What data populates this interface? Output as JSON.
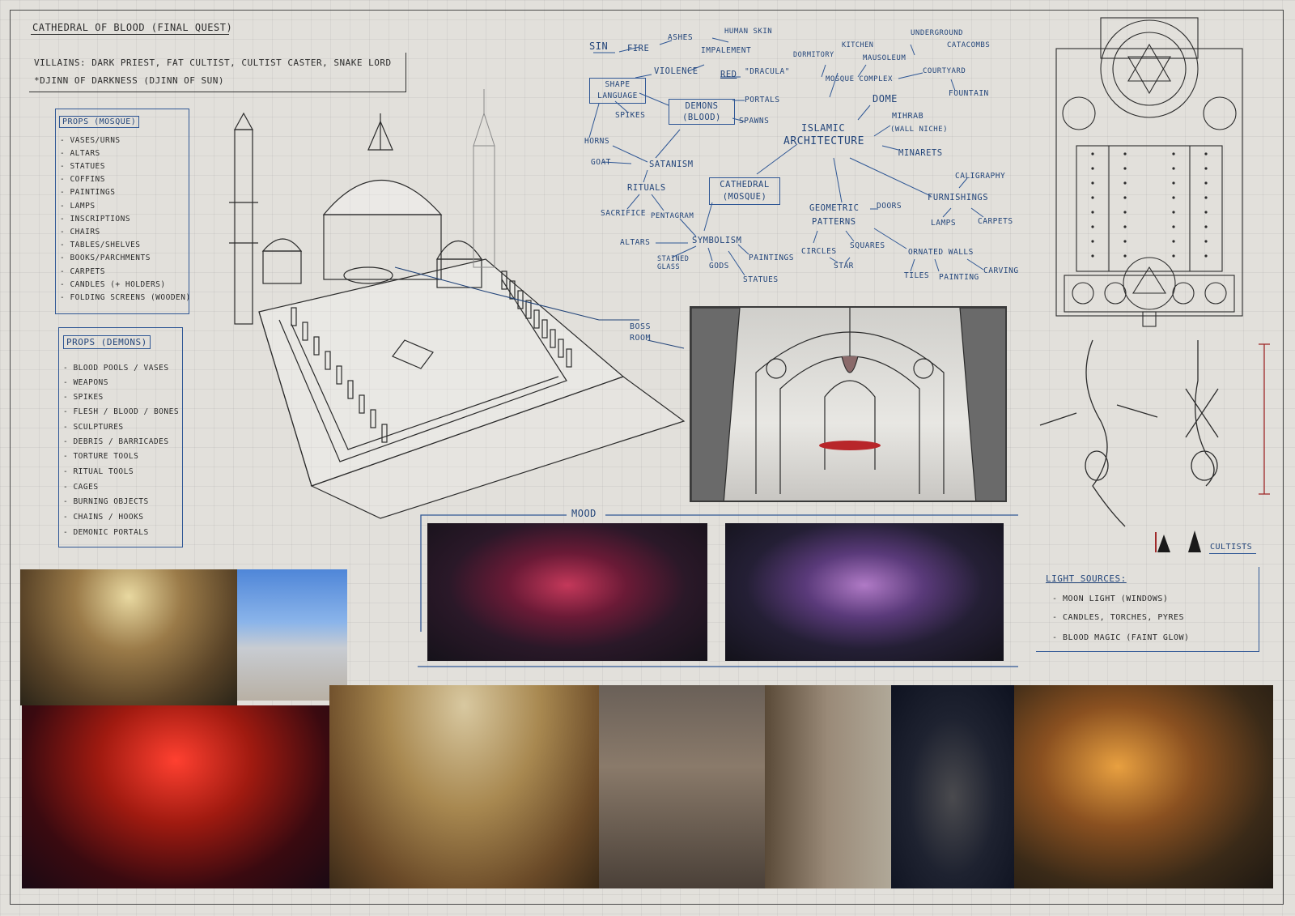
{
  "header": {
    "title": "Cathedral of Blood (Final Quest)",
    "villains": "Villains: Dark Priest, Fat Cultist, Cultist Caster, Snake Lord",
    "djinn": "*Djinn of Darkness (Djinn of Sun)"
  },
  "props_mosque": {
    "heading": "Props (Mosque)",
    "items": [
      "- Vases/Urns",
      "- Altars",
      "- Statues",
      "- Coffins",
      "- Paintings",
      "- Lamps",
      "- Inscriptions",
      "- Chairs",
      "- Tables/Shelves",
      "- Books/Parchments",
      "- Carpets",
      "- Candles (+ Holders)",
      "- Folding Screens (Wooden)"
    ]
  },
  "props_demons": {
    "heading": "Props (Demons)",
    "items": [
      "- Blood Pools / Vases",
      "- Weapons",
      "- Spikes",
      "- Flesh / Blood / Bones",
      "- Sculptures",
      "- Debris / Barricades",
      "- Torture Tools",
      "- Ritual Tools",
      "- Cages",
      "- Burning Objects",
      "- Chains / Hooks",
      "- Demonic Portals"
    ]
  },
  "mindmap": {
    "sin": "Sin",
    "fire": "Fire",
    "ashes": "Ashes",
    "human_skin": "Human Skin",
    "impalement": "Impalement",
    "violence": "Violence",
    "red": "Red",
    "dracula": "\"Dracula\"",
    "shape_language": "Shape Language",
    "demons": "Demons (Blood)",
    "portals": "Portals",
    "spawns": "Spawns",
    "spikes": "Spikes",
    "horns": "Horns",
    "goat": "Goat",
    "satanism": "Satanism",
    "rituals": "Rituals",
    "sacrifice": "Sacrifice",
    "pentagram": "Pentagram",
    "altars": "Altars",
    "symbolism": "Symbolism",
    "stained_glass": "Stained Glass",
    "gods": "Gods",
    "paintings": "Paintings",
    "statues": "Statues",
    "cathedral": "Cathedral (Mosque)",
    "dormitory": "Dormitory",
    "kitchen": "Kitchen",
    "underground": "Underground",
    "catacombs": "Catacombs",
    "mausoleum": "Mausoleum",
    "mosque_complex": "Mosque Complex",
    "courtyard": "Courtyard",
    "fountain": "Fountain",
    "dome": "Dome",
    "mihrab": "Mihrab",
    "wall_niche": "(Wall Niche)",
    "islamic": "Islamic",
    "architecture": "Architecture",
    "minarets": "Minarets",
    "caligraphy": "Caligraphy",
    "furnishings": "Furnishings",
    "lamps": "Lamps",
    "carpets": "Carpets",
    "geometric": "Geometric",
    "doors": "Doors",
    "patterns": "Patterns",
    "circles": "Circles",
    "squares": "Squares",
    "star": "Star",
    "ornated_walls": "Ornated Walls",
    "tiles": "Tiles",
    "painting": "Painting",
    "carving": "Carving"
  },
  "labels": {
    "boss": "Boss",
    "room": "Room",
    "mood": "Mood",
    "cultists": "Cultists"
  },
  "light_sources": {
    "heading": "Light Sources:",
    "items": [
      "- Moon Light (Windows)",
      "- Candles, Torches, Pyres",
      "- Blood Magic (Faint Glow)"
    ]
  },
  "colors": {
    "accent_blue": "#2f5795",
    "ink": "#2b2b2b",
    "paper": "#e2e0db"
  }
}
